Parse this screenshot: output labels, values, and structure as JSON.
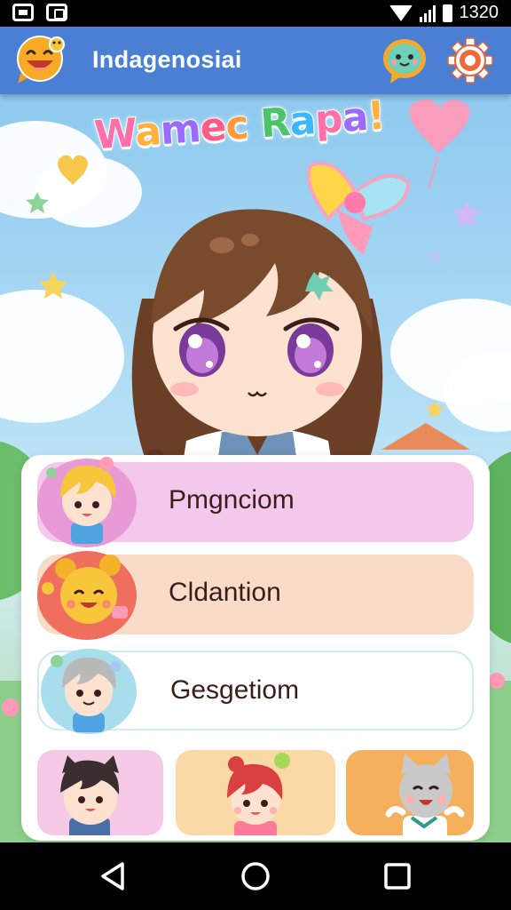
{
  "status_bar": {
    "time": "1320"
  },
  "app_bar": {
    "title": "Indagenosiai"
  },
  "banner": {
    "title_parts": [
      {
        "text": "W",
        "color": "#ff6fa8"
      },
      {
        "text": "a",
        "color": "#ffb13b"
      },
      {
        "text": "m",
        "color": "#9b6bff"
      },
      {
        "text": "e",
        "color": "#ff5c8a"
      },
      {
        "text": "c ",
        "color": "#ff9a3b"
      },
      {
        "text": "R",
        "color": "#4cc36a"
      },
      {
        "text": "a",
        "color": "#3fb7ff"
      },
      {
        "text": "p",
        "color": "#ff6fa8"
      },
      {
        "text": "a",
        "color": "#9b6bff"
      },
      {
        "text": "!",
        "color": "#ffb13b"
      }
    ]
  },
  "menu": {
    "items": [
      {
        "label": "Pmgnciom",
        "icon": "blonde-child-avatar-icon",
        "color": "#f4c8ec"
      },
      {
        "label": "Cldantion",
        "icon": "yellow-bear-avatar-icon",
        "color": "#f9dcc8"
      },
      {
        "label": "Gesgetiom",
        "icon": "grey-haired-child-avatar-icon",
        "color": "#ffffff"
      }
    ],
    "tiles": [
      {
        "icon": "cat-eared-boy-avatar-icon",
        "color": "#f6c9e6"
      },
      {
        "icon": "red-haired-girl-avatar-icon",
        "color": "#fbd9a6"
      },
      {
        "icon": "grey-cat-avatar-icon",
        "color": "#f5b05d"
      }
    ]
  },
  "nav": {
    "back": "back-icon",
    "home": "home-icon",
    "recents": "recents-icon"
  }
}
